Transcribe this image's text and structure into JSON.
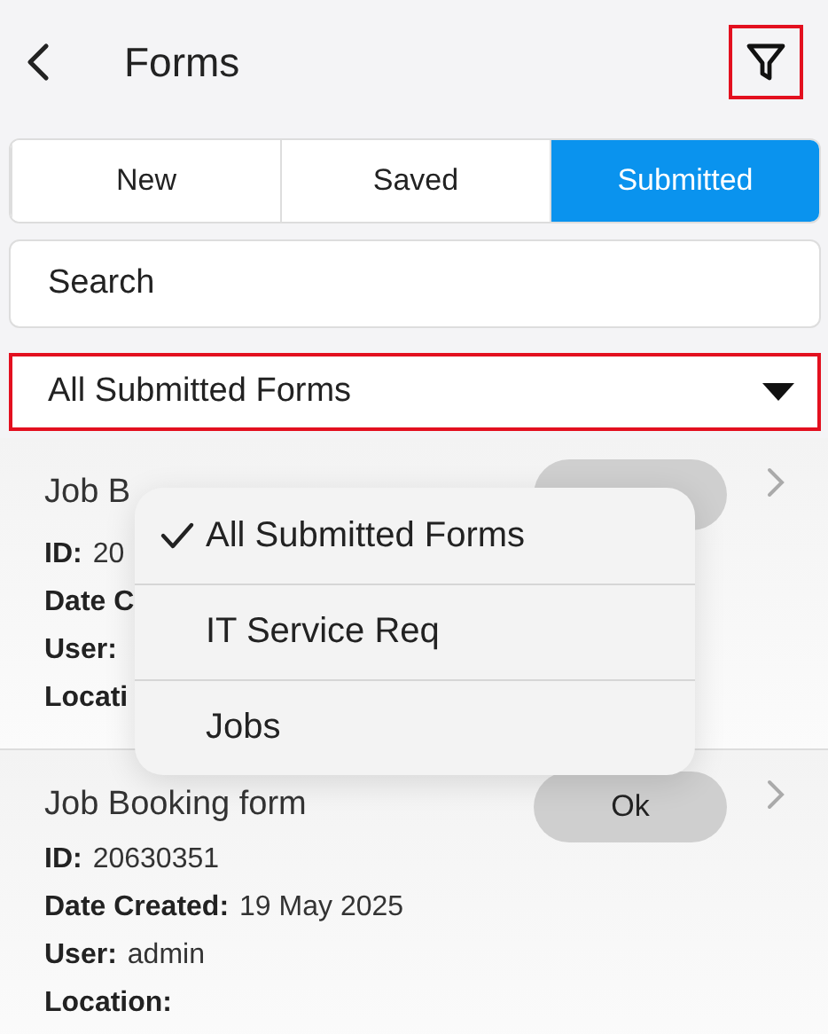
{
  "header": {
    "title": "Forms",
    "filter_highlighted": true
  },
  "tabs": [
    {
      "label": "New",
      "selected": false
    },
    {
      "label": "Saved",
      "selected": false
    },
    {
      "label": "Submitted",
      "selected": true
    }
  ],
  "search": {
    "placeholder": "Search"
  },
  "filter": {
    "value": "All Submitted Forms",
    "highlighted": true
  },
  "cards": [
    {
      "title": "Job B",
      "status_pill": true,
      "fields": [
        {
          "label": "ID:",
          "value": "20"
        },
        {
          "label": "Date C"
        },
        {
          "label": "User:"
        },
        {
          "label": "Locati"
        }
      ]
    },
    {
      "title": "Job Booking form",
      "status": "Ok",
      "fields": [
        {
          "label": "ID:",
          "value": "20630351"
        },
        {
          "label": "Date Created:",
          "value": "19 May 2025"
        },
        {
          "label": "User:",
          "value": "admin"
        },
        {
          "label": "Location:"
        }
      ]
    }
  ],
  "menu": {
    "items": [
      {
        "label": "All Submitted Forms",
        "selected": true
      },
      {
        "label": "IT Service Req",
        "selected": false
      },
      {
        "label": "Jobs",
        "selected": false
      }
    ]
  }
}
